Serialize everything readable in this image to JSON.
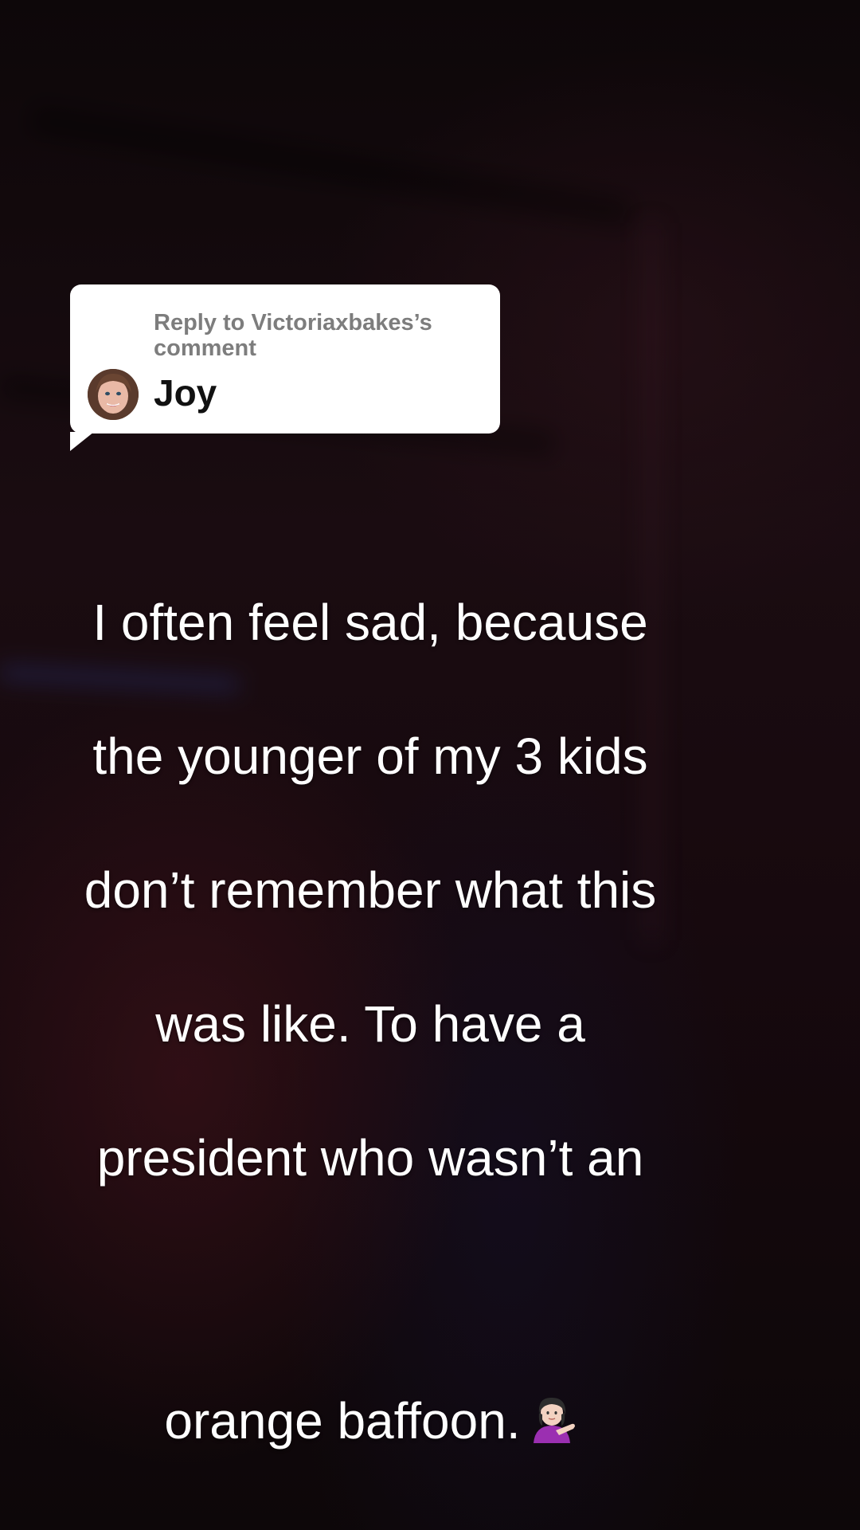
{
  "reply_card": {
    "heading": "Reply to Victoriaxbakes’s comment",
    "commenter_name": "Joy",
    "avatar_icon": "user-avatar-photo"
  },
  "caption": {
    "lines": [
      "I often feel sad, because",
      "the younger of my 3 kids",
      "don’t remember what this",
      "was like. To have a",
      "president who wasn’t an",
      "orange baffoon."
    ],
    "emoji_icon": "woman-tipping-hand-emoji"
  },
  "colors": {
    "bubble_background": "#ffffff",
    "heading_gray": "#7d7d7d",
    "caption_text": "#ffffff",
    "background": "#140a0d"
  }
}
